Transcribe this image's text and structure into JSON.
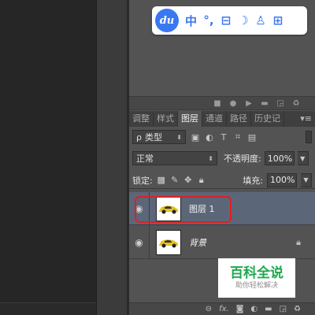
{
  "ime_bar": {
    "logo": "du",
    "items": [
      "中",
      "°,",
      "⊟",
      "☽",
      "♙",
      "⊞"
    ]
  },
  "panel": {
    "tabs": [
      {
        "label": "调整",
        "active": false
      },
      {
        "label": "样式",
        "active": false
      },
      {
        "label": "图层",
        "active": true
      },
      {
        "label": "通道",
        "active": false
      },
      {
        "label": "路径",
        "active": false
      },
      {
        "label": "历史记",
        "active": false
      }
    ],
    "tab_menu": "▾≡",
    "filter": {
      "search_glyph": "ρ",
      "kind_label": "类型"
    },
    "blend": {
      "mode": "正常",
      "opacity_label": "不透明度:",
      "opacity_value": "100%"
    },
    "lock": {
      "label": "锁定:",
      "fill_label": "填充:",
      "fill_value": "100%"
    },
    "layers": [
      {
        "name": "图层 1",
        "selected": true,
        "locked": false
      },
      {
        "name": "背景",
        "selected": false,
        "locked": true
      }
    ]
  },
  "watermark": {
    "main": "百科全说",
    "sub": "助你轻松解决"
  },
  "colors": {
    "accent": "#3a78f2",
    "selection": "#5b6778",
    "highlight": "#e02020",
    "watermark": "#1fa94f"
  }
}
